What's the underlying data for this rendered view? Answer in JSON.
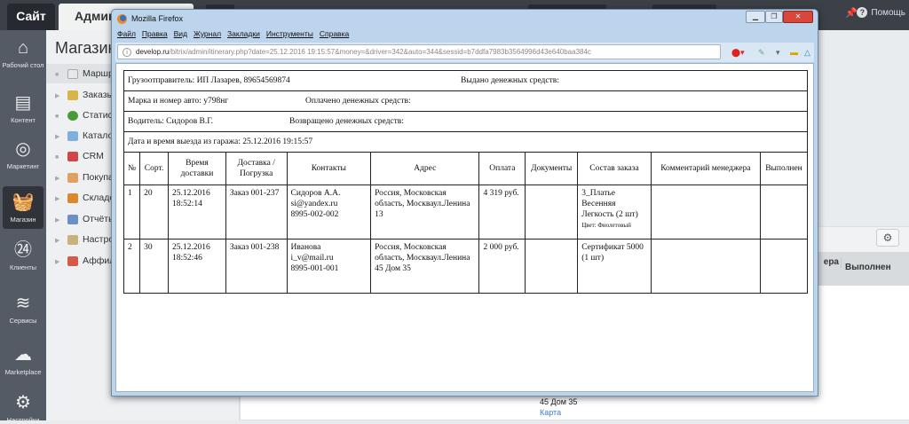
{
  "topbar": {
    "site_tab": "Сайт",
    "admin_tab": "Администрирование",
    "help": "Помощь"
  },
  "sidebar": {
    "items": [
      {
        "icon": "home-icon",
        "label": "Рабочий стол"
      },
      {
        "icon": "document-icon",
        "label": "Контент"
      },
      {
        "icon": "target-icon",
        "label": "Маркетинг"
      },
      {
        "icon": "basket-icon",
        "label": "Магазин"
      },
      {
        "icon": "clients-24-icon",
        "label": "Клиенты"
      },
      {
        "icon": "layers-icon",
        "label": "Сервисы"
      },
      {
        "icon": "cloud-download-icon",
        "label": "Marketplace"
      },
      {
        "icon": "gear-icon",
        "label": "Настройки"
      }
    ]
  },
  "panel": {
    "title": "Магазин",
    "items": [
      {
        "label": "Маршруты",
        "color": "#e8e8e8"
      },
      {
        "label": "Заказы",
        "color": "#d6b64a"
      },
      {
        "label": "Статистика",
        "color": "#4a9a3c"
      },
      {
        "label": "Каталог товаров",
        "color": "#7fb0dc"
      },
      {
        "label": "CRM",
        "color": "#d04646"
      },
      {
        "label": "Покупатели",
        "color": "#e0a060"
      },
      {
        "label": "Складской учёт",
        "color": "#d88a2c"
      },
      {
        "label": "Отчёты",
        "color": "#6c8fc8"
      },
      {
        "label": "Настройки",
        "color": "#c8b27a"
      },
      {
        "label": "Аффилиаты",
        "color": "#d45a4a"
      }
    ]
  },
  "background_page": {
    "col_comment": "Комментарий менеджера",
    "col_done": "Выполнен",
    "address_tail": "45 Дом 35",
    "map_link": "Карта"
  },
  "browser": {
    "title": "Mozilla Firefox",
    "menu": [
      "Файл",
      "Правка",
      "Вид",
      "Журнал",
      "Закладки",
      "Инструменты",
      "Справка"
    ],
    "url_host": "develop.ru",
    "url_path": "/bitrix/admin/itinerary.php?date=25.12.2016 19:15:57&money=&driver=342&auto=344&sessid=b7ddfa7983b3564996d43e640baa384c"
  },
  "itinerary": {
    "shipper": "Грузоотправитель: ИП Лазарев, 89654569874",
    "issued": "Выдано денежных средств:",
    "car": "Марка и номер авто: у798нг",
    "paid": "Оплачено денежных средств:",
    "driver": "Водитель: Сидоров В.Г.",
    "returned": "Возвращено денежных средств:",
    "departure": "Дата и время выезда из гаража: 25.12.2016 19:15:57",
    "columns": [
      "№",
      "Сорт.",
      "Время доставки",
      "Доставка / Погрузка",
      "Контакты",
      "Адрес",
      "Оплата",
      "Документы",
      "Состав заказа",
      "Комментарий менеджера",
      "Выполнен"
    ],
    "rows": [
      {
        "num": "1",
        "sort": "20",
        "date": "25.12.2016",
        "time": "18:52:14",
        "order": "Заказ 001-237",
        "name": "Сидоров А.А.",
        "email": "si@yandex.ru",
        "phone": "8995-002-002",
        "address": "Россия, Московская область, Москваул.Ленина 13",
        "payment": "4 319 руб.",
        "documents": "",
        "items": "3_Платье Весенняя Легкость (2 шт)",
        "item_note": "Цвет: Фиолетовый",
        "comment": "",
        "done": ""
      },
      {
        "num": "2",
        "sort": "30",
        "date": "25.12.2016",
        "time": "18:52:46",
        "order": "Заказ 001-238",
        "name": "Иванова",
        "email": "i_v@mail.ru",
        "phone": "8995-001-001",
        "address": "Россия, Московская область, Москваул.Ленина 45 Дом 35",
        "payment": "2 000 руб.",
        "documents": "",
        "items": "Сертификат 5000 (1 шт)",
        "item_note": "",
        "comment": "",
        "done": ""
      }
    ]
  }
}
